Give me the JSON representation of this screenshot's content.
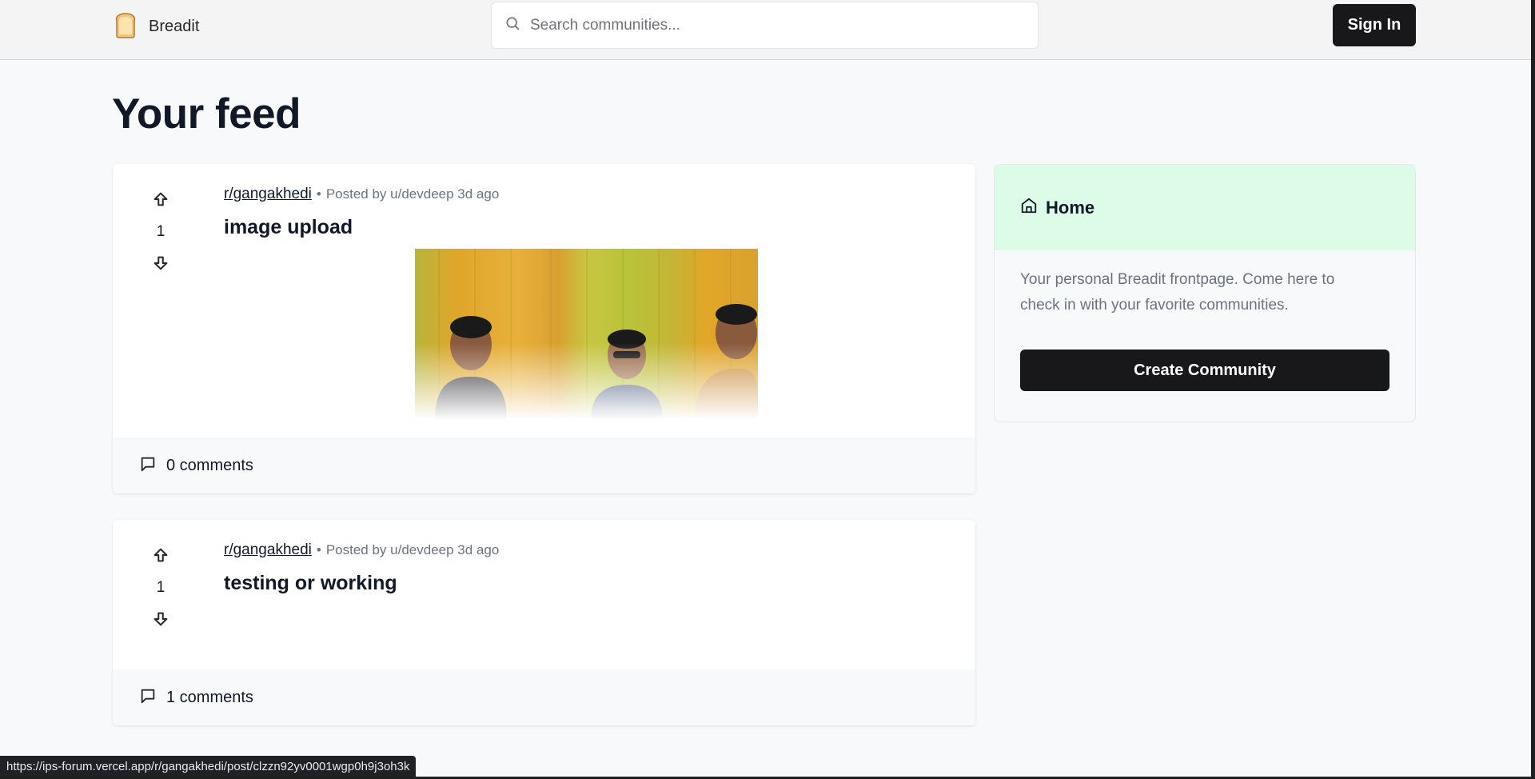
{
  "navbar": {
    "brand": "Breadit",
    "search_placeholder": "Search communities...",
    "signin_label": "Sign In"
  },
  "page": {
    "title": "Your feed"
  },
  "posts": [
    {
      "subreddit": "r/gangakhedi",
      "dot": "•",
      "posted_by": "Posted by u/devdeep 3d ago",
      "title": "image upload",
      "votes": "1",
      "comments": "0 comments",
      "has_image": true
    },
    {
      "subreddit": "r/gangakhedi",
      "dot": "•",
      "posted_by": "Posted by u/devdeep 3d ago",
      "title": "testing or working",
      "votes": "1",
      "comments": "1 comments",
      "has_image": false
    }
  ],
  "sidebar": {
    "title": "Home",
    "description": "Your personal Breadit frontpage. Come here to check in with your favorite communities.",
    "create_label": "Create Community",
    "header_color": "#dcfce7"
  },
  "status_bar": {
    "url": "https://ips-forum.vercel.app/r/gangakhedi/post/clzzn92yv0001wgp0h9j3oh3k"
  },
  "icons": {
    "brand": "bread-icon",
    "search": "search-icon",
    "upvote": "arrow-up-icon",
    "downvote": "arrow-down-icon",
    "comments": "message-square-icon",
    "home": "home-icon"
  },
  "colors": {
    "primary_button": "#18181b",
    "page_bg": "#f8f9fa",
    "navbar_bg": "#f4f4f5"
  }
}
